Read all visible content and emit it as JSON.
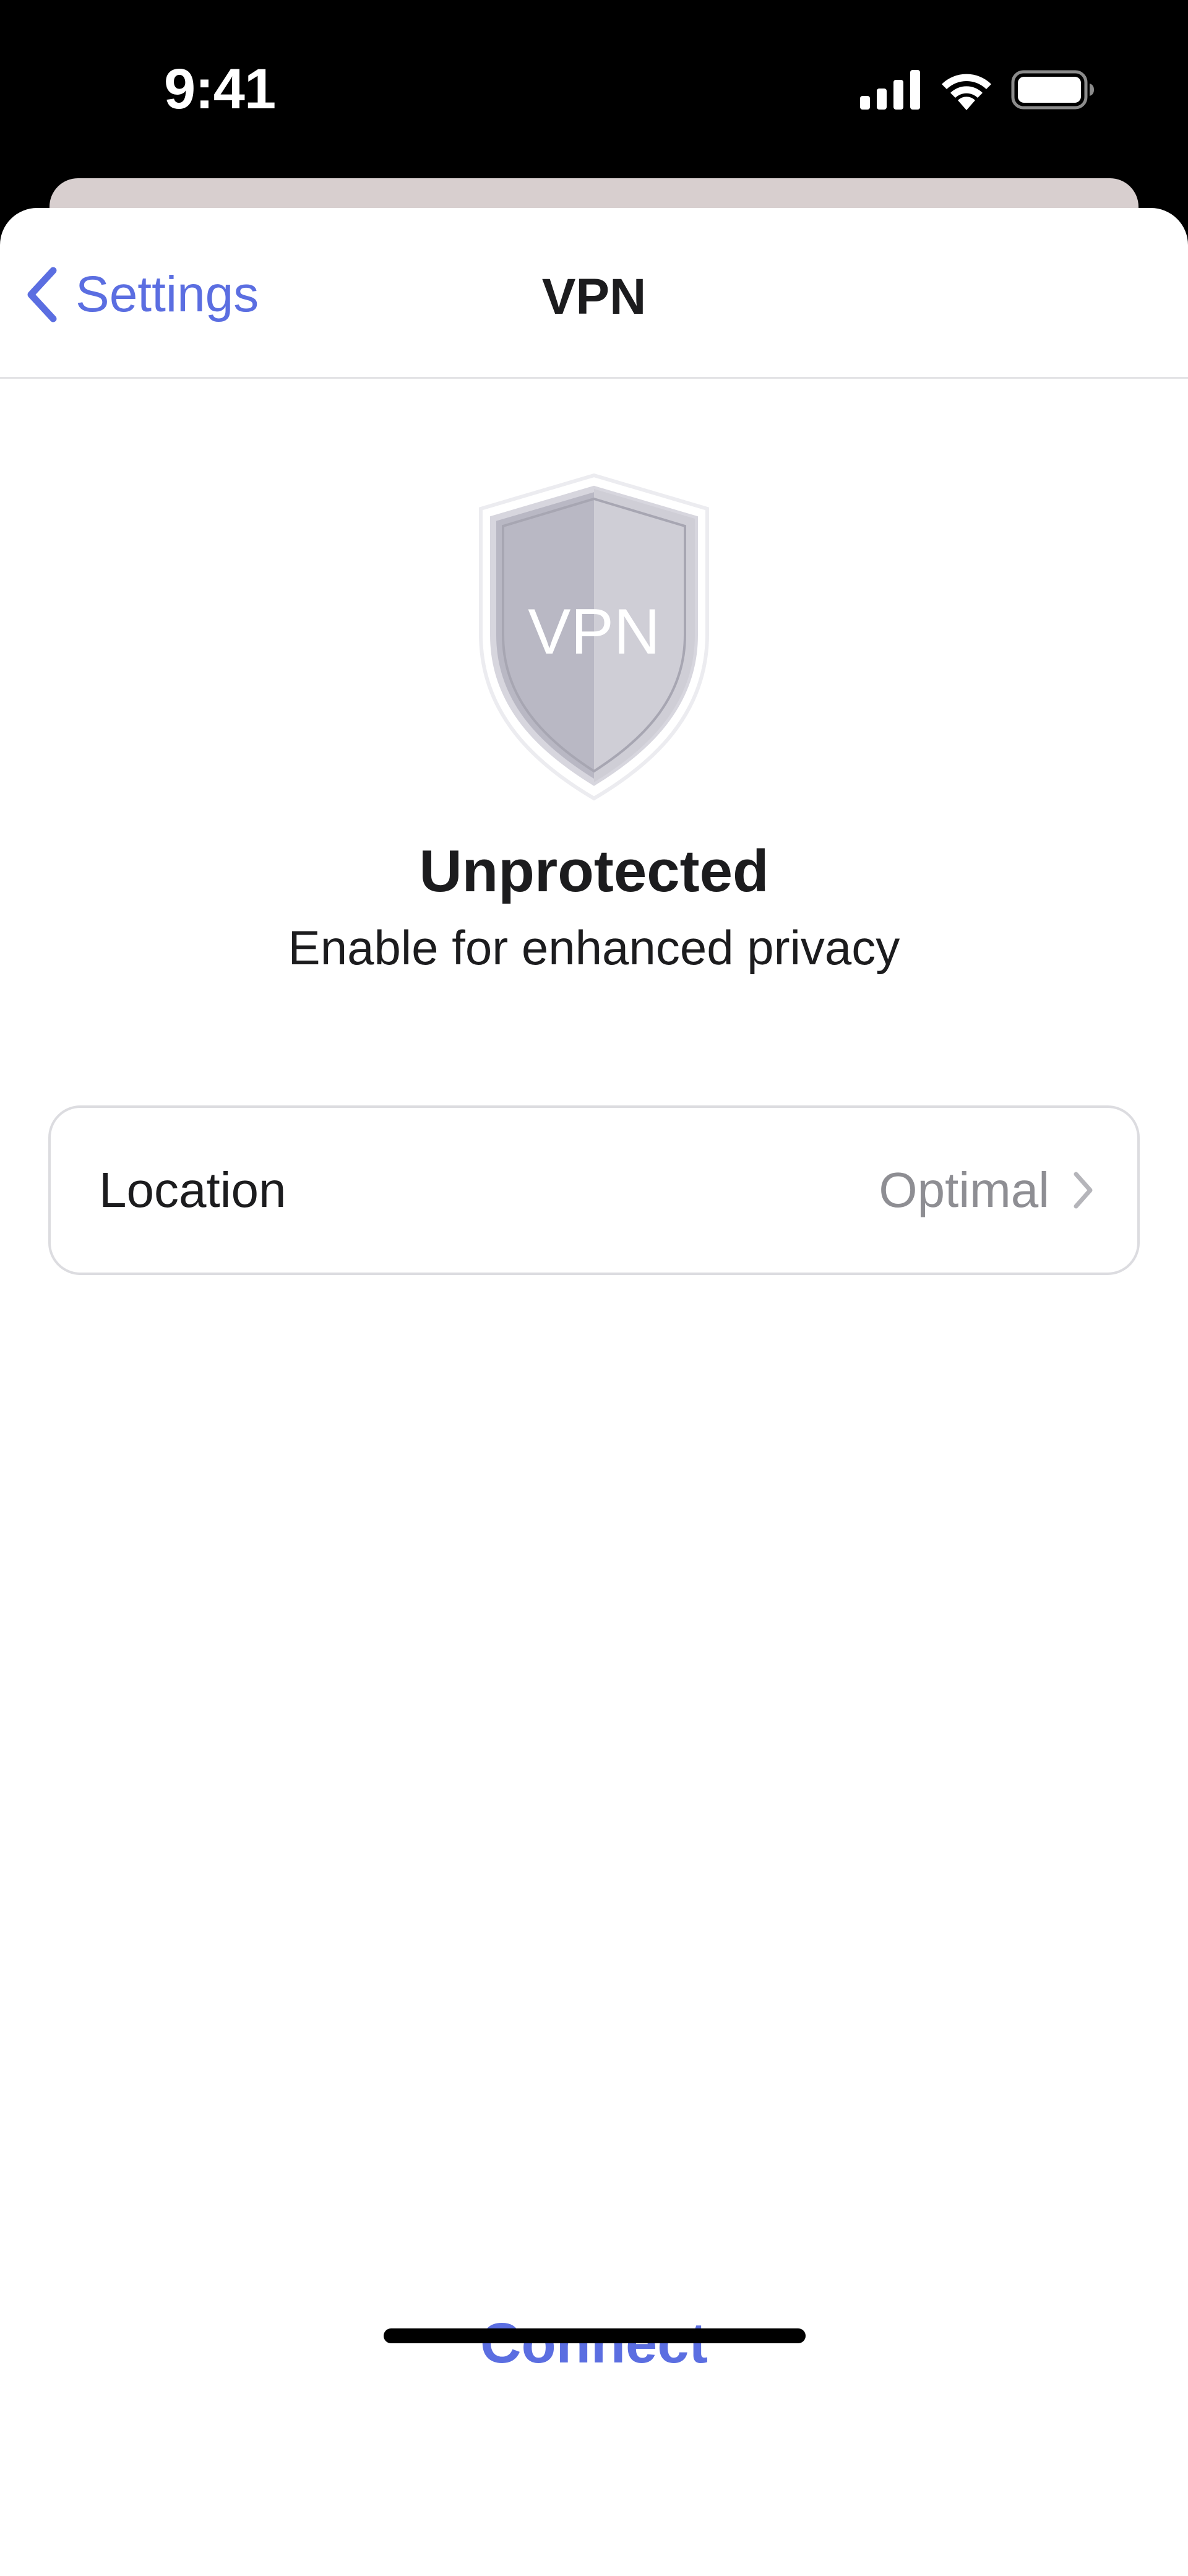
{
  "status_bar": {
    "time": "9:41",
    "icons": [
      "cellular-signal-icon",
      "wifi-icon",
      "battery-icon"
    ]
  },
  "nav": {
    "back_label": "Settings",
    "back_icon": "chevron-left-icon",
    "title": "VPN"
  },
  "shield": {
    "icon": "vpn-shield-icon",
    "label": "VPN"
  },
  "status": {
    "title": "Unprotected",
    "subtitle": "Enable for enhanced privacy"
  },
  "location": {
    "label": "Location",
    "value": "Optimal",
    "icon": "chevron-right-icon"
  },
  "actions": {
    "connect_label": "Connect"
  },
  "colors": {
    "accent": "#5b6ee1",
    "text_primary": "#1c1c1e",
    "text_secondary": "#8e8e93",
    "shield_fill": "#b9b8c4"
  }
}
